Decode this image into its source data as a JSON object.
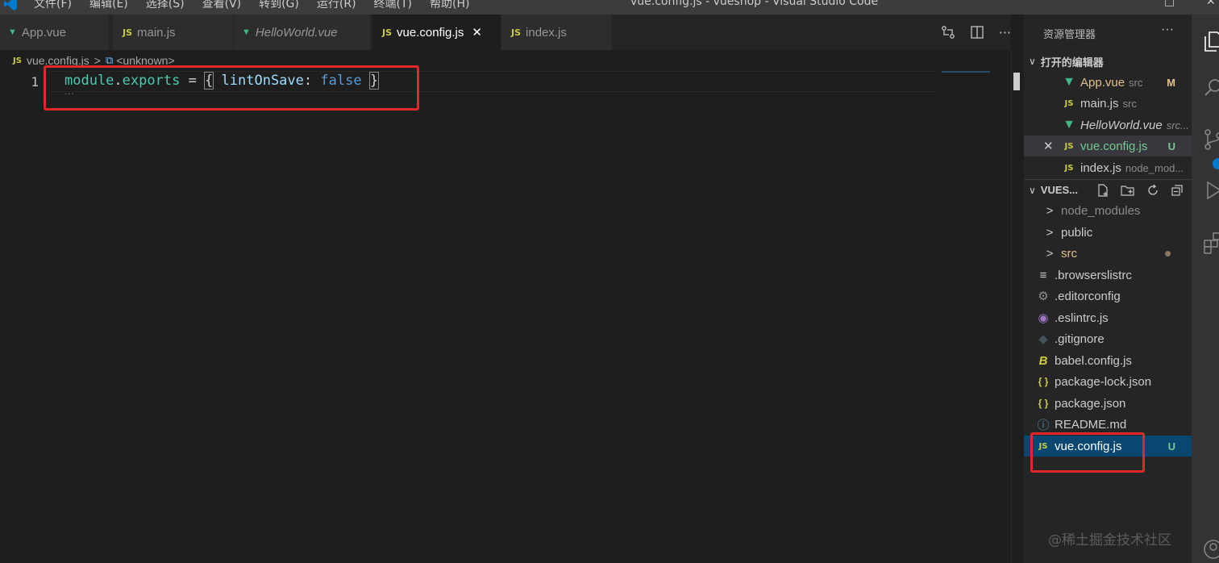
{
  "titlebar": {
    "menu": [
      "文件(F)",
      "编辑(E)",
      "选择(S)",
      "查看(V)",
      "转到(G)",
      "运行(R)",
      "终端(T)",
      "帮助(H)"
    ],
    "title": "vue.config.js - vueshop - Visual Studio Code",
    "restore_glyph": "□",
    "close_glyph": "✕"
  },
  "tabs": [
    {
      "label": "App.vue",
      "icon": "vue-icon",
      "italic": false,
      "active": false
    },
    {
      "label": "main.js",
      "icon": "js-icon",
      "italic": false,
      "active": false
    },
    {
      "label": "HelloWorld.vue",
      "icon": "vue-icon",
      "italic": true,
      "active": false
    },
    {
      "label": "vue.config.js",
      "icon": "js-icon",
      "italic": false,
      "active": true,
      "close": "✕"
    },
    {
      "label": "index.js",
      "icon": "js-icon",
      "italic": false,
      "active": false
    }
  ],
  "icon_text": {
    "js": "JS",
    "more": "···"
  },
  "breadcrumb": {
    "file": "vue.config.js",
    "separator": ">",
    "symbol": "<unknown>"
  },
  "editor": {
    "line_number": "1",
    "code": {
      "module": "module",
      "dot": ".",
      "exports": "exports",
      "eq": " = ",
      "open": "{",
      "key": " lintOnSave",
      "colon": ": ",
      "value": "false",
      "space": " ",
      "close": "}"
    },
    "squiggle": "···"
  },
  "sidebar": {
    "title": "资源管理器",
    "open_editors": {
      "title": "打开的编辑器",
      "items": [
        {
          "name": "App.vue",
          "desc": "src",
          "badge": "M",
          "icon": "vue-icon"
        },
        {
          "name": "main.js",
          "desc": "src",
          "badge": "",
          "icon": "js-icon"
        },
        {
          "name": "HelloWorld.vue",
          "desc": "src...",
          "badge": "",
          "icon": "vue-icon"
        },
        {
          "name": "vue.config.js",
          "desc": "",
          "badge": "U",
          "icon": "js-icon",
          "close": "✕"
        },
        {
          "name": "index.js",
          "desc": "node_mod...",
          "badge": "",
          "icon": "js-icon"
        }
      ]
    },
    "project": {
      "title": "VUES...",
      "items": [
        {
          "name": "node_modules",
          "type": "folder"
        },
        {
          "name": "public",
          "type": "folder"
        },
        {
          "name": "src",
          "type": "folder",
          "modified_dot": true
        },
        {
          "name": ".browserslistrc",
          "type": "file",
          "icon_glyph": "≡"
        },
        {
          "name": ".editorconfig",
          "type": "file",
          "icon_glyph": "⚙"
        },
        {
          "name": ".eslintrc.js",
          "type": "file",
          "icon_glyph": "◉"
        },
        {
          "name": ".gitignore",
          "type": "file",
          "icon_glyph": "◆"
        },
        {
          "name": "babel.config.js",
          "type": "file",
          "icon_glyph": "B"
        },
        {
          "name": "package-lock.json",
          "type": "file",
          "icon_glyph": "{ }"
        },
        {
          "name": "package.json",
          "type": "file",
          "icon_glyph": "{ }"
        },
        {
          "name": "README.md",
          "type": "file",
          "icon_glyph": "ⓘ"
        },
        {
          "name": "vue.config.js",
          "type": "file",
          "icon_glyph": "JS",
          "badge": "U",
          "selected": true
        }
      ]
    },
    "chevron_open": "∨",
    "chevron_closed": ">"
  },
  "watermark": "@稀土掘金技术社区",
  "colors": {
    "accent": "#007acc",
    "highlight_box": "#e02828",
    "selection": "#094771",
    "untracked": "#73c991",
    "modified": "#e2c08d"
  }
}
